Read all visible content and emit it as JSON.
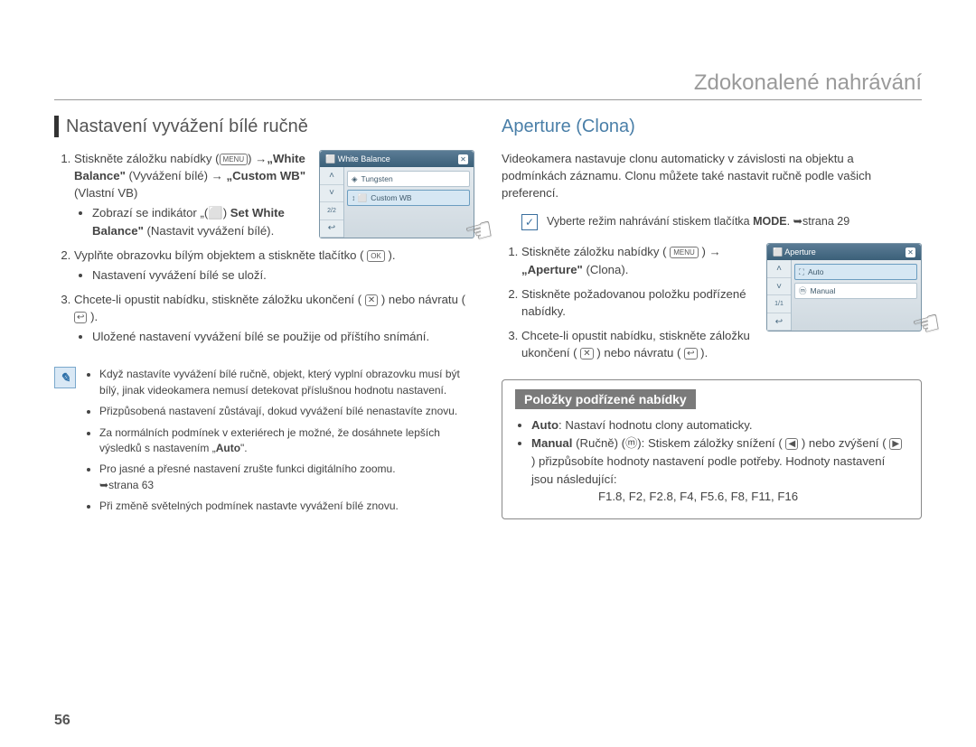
{
  "header": {
    "title": "Zdokonalené nahrávání"
  },
  "page_number": "56",
  "left": {
    "heading": "Nastavení vyvážení bílé ručně",
    "menu_screenshot": {
      "title": "White Balance",
      "row1": "Tungsten",
      "row2": "Custom WB",
      "page_indicator": "2/2"
    },
    "step1_a": "Stiskněte záložku nabídky",
    "step1_b": "„White Balance\"",
    "step1_c": "(Vyvážení bílé)",
    "step1_d": "„Custom WB\"",
    "step1_e": "(Vlastní VB)",
    "step1_sub_a": "Zobrazí se indikátor „(",
    "step1_sub_b": ")",
    "step1_sub_c": "Set White Balance\"",
    "step1_sub_d": "(Nastavit vyvážení bílé).",
    "step2_a": "Vyplňte obrazovku bílým objektem a stiskněte tlačítko (",
    "step2_b": ").",
    "step2_sub": "Nastavení vyvážení bílé se uloží.",
    "step3_a": "Chcete-li opustit nabídku, stiskněte záložku ukončení (",
    "step3_b": ") nebo návratu (",
    "step3_c": ").",
    "step3_sub": "Uložené nastavení vyvážení bílé se použije od příštího snímání.",
    "notes": {
      "n1": "Když nastavíte vyvážení bílé ručně, objekt, který vyplní obrazovku musí být bílý, jinak videokamera nemusí detekovat příslušnou hodnotu nastavení.",
      "n2": "Přizpůsobená nastavení zůstávají, dokud vyvážení bílé nenastavíte znovu.",
      "n3_a": "Za normálních podmínek v exteriérech je možné, že dosáhnete lepších výsledků s nastavením „",
      "n3_b": "Auto",
      "n3_c": "\".",
      "n4_a": "Pro jasné a přesné nastavení zrušte funkci digitálního zoomu.",
      "n4_b": "strana 63",
      "n5": "Při změně světelných podmínek nastavte vyvážení bílé znovu."
    }
  },
  "right": {
    "heading": "Aperture (Clona)",
    "intro": "Videokamera nastavuje clonu automaticky v závislosti na objektu a podmínkách záznamu. Clonu můžete také nastavit ručně podle vašich preferencí.",
    "check_a": "Vyberte režim nahrávání stiskem tlačítka ",
    "check_b": "MODE",
    "check_c": ". ",
    "check_d": "strana 29",
    "menu_screenshot": {
      "title": "Aperture",
      "row1": "Auto",
      "row2": "Manual",
      "page_indicator": "1/1"
    },
    "step1_a": "Stiskněte záložku nabídky (",
    "step1_b": ")",
    "step1_c": "„Aperture\"",
    "step1_d": "(Clona).",
    "step2": "Stiskněte požadovanou položku podřízené nabídky.",
    "step3_a": "Chcete-li opustit nabídku, stiskněte záložku ukončení (",
    "step3_b": ") nebo návratu (",
    "step3_c": ").",
    "subbox": {
      "title": "Položky podřízené nabídky",
      "auto_label": "Auto",
      "auto_text": ": Nastaví hodnotu clony automaticky.",
      "manual_label": "Manual",
      "manual_paren": "(Ručně) (",
      "manual_a": "): Stiskem záložky snížení (",
      "manual_b": ") nebo zvýšení (",
      "manual_c": ") přizpůsobíte hodnoty nastavení podle potřeby. Hodnoty nastavení jsou následující:",
      "values": "F1.8, F2, F2.8, F4, F5.6, F8, F11, F16"
    }
  },
  "icons": {
    "menu": "MENU",
    "ok": "OK",
    "close": "✕",
    "back": "↩",
    "arrow": "→",
    "link_arrow": "➥",
    "wb_set": "⬜",
    "m_circle": "ⓜ",
    "minus": "◀",
    "plus": "▶"
  }
}
